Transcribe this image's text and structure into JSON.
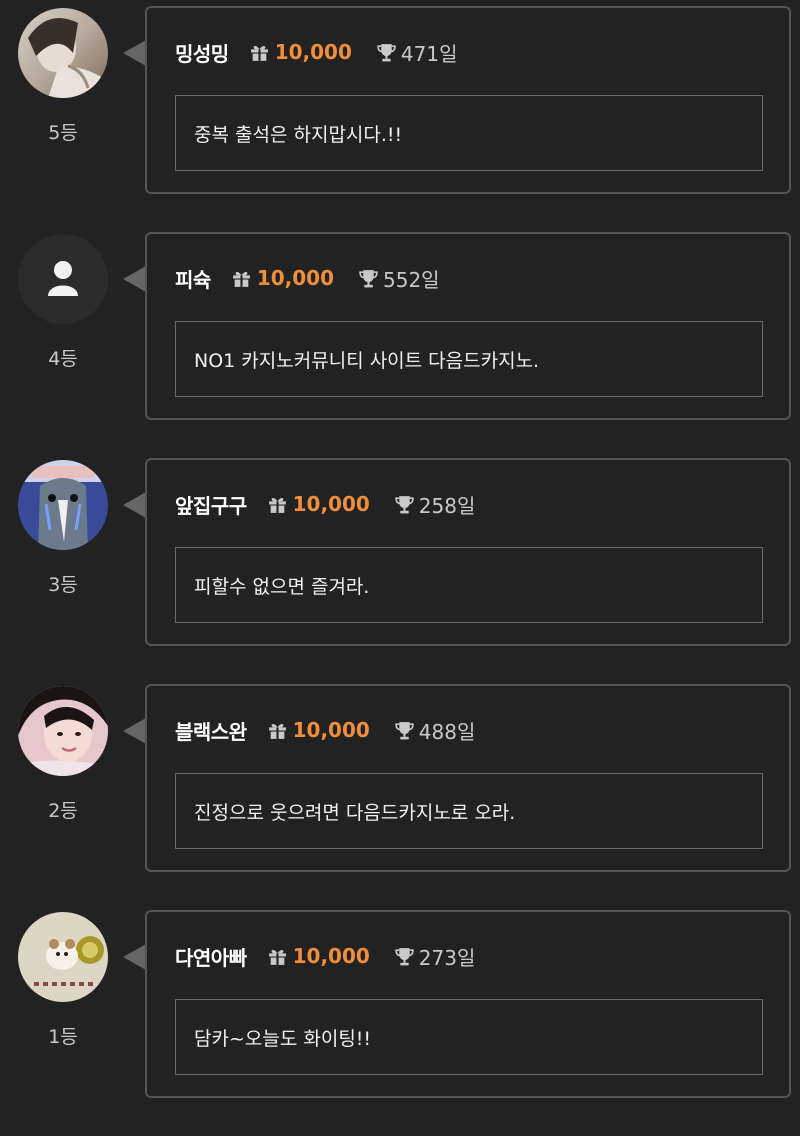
{
  "colors": {
    "background": "#222222",
    "card_border": "#555555",
    "comment_border": "#6a6a6a",
    "points": "#f08f3b",
    "muted_text": "#c9c9c9"
  },
  "icons": {
    "points": "gift-icon",
    "days": "trophy-icon",
    "default_avatar": "user-icon"
  },
  "entries": [
    {
      "nickname": "밍성밍",
      "points": "10,000",
      "days": "471일",
      "comment": "중복 출석은 하지맙시다.!!",
      "rank": "5등",
      "avatar": "photo"
    },
    {
      "nickname": "피슉",
      "points": "10,000",
      "days": "552일",
      "comment": "NO1 카지노커뮤니티 사이트 다음드카지노.",
      "rank": "4등",
      "avatar": "default"
    },
    {
      "nickname": "앞집구구",
      "points": "10,000",
      "days": "258일",
      "comment": "피할수 없으면 즐겨라.",
      "rank": "3등",
      "avatar": "photo"
    },
    {
      "nickname": "블랙스완",
      "points": "10,000",
      "days": "488일",
      "comment": "진정으로 웃으려면 다음드카지노로 오라.",
      "rank": "2등",
      "avatar": "photo"
    },
    {
      "nickname": "다연아빠",
      "points": "10,000",
      "days": "273일",
      "comment": "담카~오늘도 화이팅!!",
      "rank": "1등",
      "avatar": "photo"
    }
  ]
}
